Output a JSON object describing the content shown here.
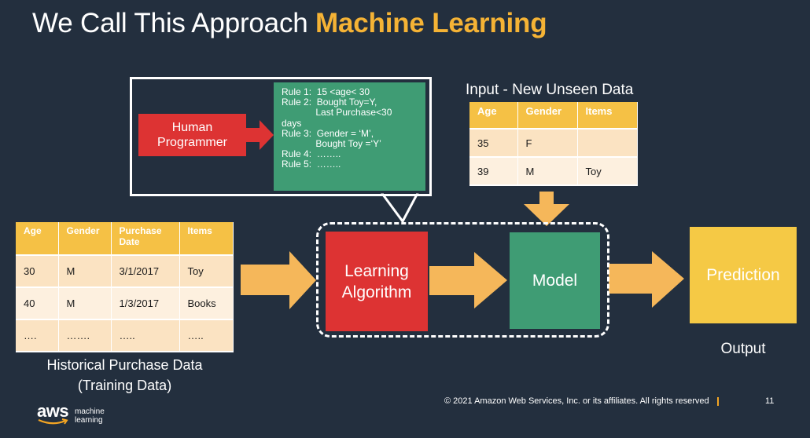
{
  "title": {
    "prefix": "We Call This Approach ",
    "highlight": "Machine Learning"
  },
  "human_programmer": "Human Programmer",
  "rules": [
    "Rule 1:  15 <age< 30",
    "Rule 2:  Bought Toy=Y,",
    "             Last Purchase<30",
    "days",
    "Rule 3:  Gender = ‘M’,",
    "             Bought Toy =‘Y’",
    "Rule 4:  ……..",
    "Rule 5:  ……..",
    ""
  ],
  "input_table": {
    "label": "Input - New Unseen Data",
    "headers": [
      "Age",
      "Gender",
      "Items"
    ],
    "rows": [
      [
        "35",
        "F",
        ""
      ],
      [
        "39",
        "M",
        "Toy"
      ]
    ]
  },
  "historical_table": {
    "label_line1": "Historical Purchase Data",
    "label_line2": "(Training Data)",
    "headers": [
      "Age",
      "Gender",
      "Purchase Date",
      "Items"
    ],
    "rows": [
      [
        "30",
        "M",
        "3/1/2017",
        "Toy"
      ],
      [
        "40",
        "M",
        "1/3/2017",
        "Books"
      ],
      [
        "….",
        "…….",
        "…..",
        "….."
      ]
    ]
  },
  "learning_algorithm": "Learning Algorithm",
  "model": "Model",
  "prediction": "Prediction",
  "output_label": "Output",
  "footer": {
    "copyright": "© 2021 Amazon Web Services, Inc. or its affiliates. All rights reserved",
    "page": "11"
  },
  "logo": {
    "brand": "aws",
    "line1": "machine",
    "line2": "learning"
  },
  "colors": {
    "background": "#232f3e",
    "accent": "#f5b335",
    "red": "#dd3333",
    "green": "#3f9c74",
    "yellow": "#f5c945",
    "arrow": "#f5b75a"
  }
}
